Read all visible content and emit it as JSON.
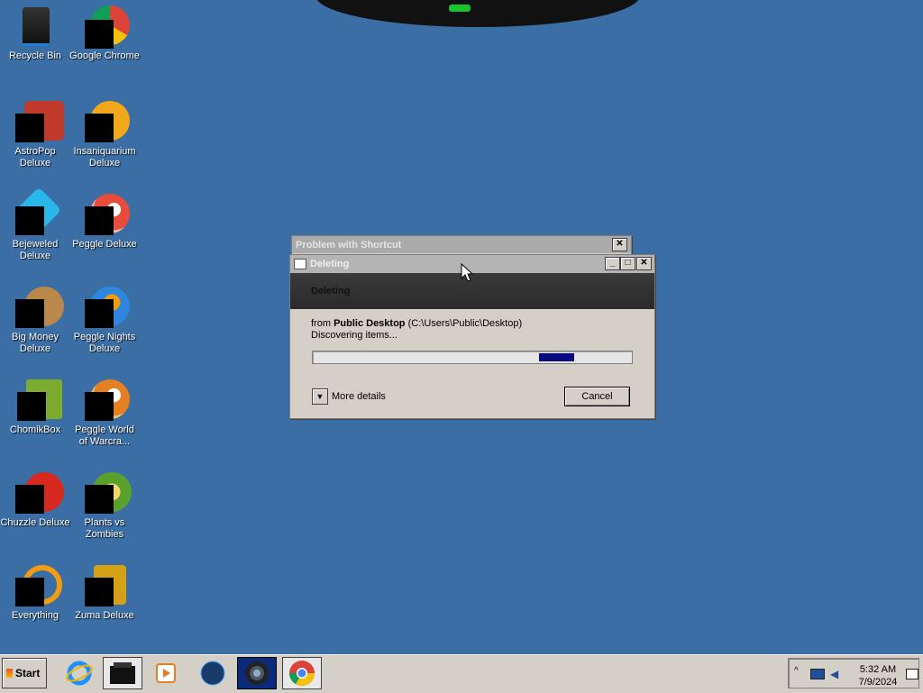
{
  "desktop": {
    "icons": [
      {
        "label": "Recycle Bin",
        "icon": "recycle-bin-icon"
      },
      {
        "label": "Google Chrome",
        "icon": "chrome-icon"
      },
      {
        "label": "AstroPop Deluxe",
        "icon": "astropop-icon"
      },
      {
        "label": "Insaniquarium Deluxe",
        "icon": "insaniquarium-icon"
      },
      {
        "label": "Bejeweled Deluxe",
        "icon": "bejeweled-icon"
      },
      {
        "label": "Peggle Deluxe",
        "icon": "peggle-icon"
      },
      {
        "label": "Big Money Deluxe",
        "icon": "big-money-icon"
      },
      {
        "label": "Peggle Nights Deluxe",
        "icon": "peggle-nights-icon"
      },
      {
        "label": "ChomikBox",
        "icon": "chomikbox-icon"
      },
      {
        "label": "Peggle World of Warcra...",
        "icon": "peggle-wow-icon"
      },
      {
        "label": "Chuzzle Deluxe",
        "icon": "chuzzle-icon"
      },
      {
        "label": "Plants vs Zombies",
        "icon": "plants-vs-zombies-icon"
      },
      {
        "label": "Everything",
        "icon": "everything-icon"
      },
      {
        "label": "Zuma Deluxe",
        "icon": "zuma-icon"
      }
    ]
  },
  "shortcut_dialog": {
    "title": "Problem with Shortcut",
    "close": "✕"
  },
  "deleting_dialog": {
    "title": "Deleting",
    "minimize": "_",
    "maximize": "□",
    "close": "✕",
    "header": "Deleting",
    "from_prefix": "from",
    "from_name": "Public Desktop",
    "from_path": "(C:\\Users\\Public\\Desktop)",
    "status": "Discovering items...",
    "progress_fraction": 0.11,
    "more_details": "More details",
    "cancel": "Cancel"
  },
  "taskbar": {
    "start": "Start",
    "items": [
      {
        "icon": "internet-explorer-icon"
      },
      {
        "icon": "folder-box-icon"
      },
      {
        "icon": "media-player-icon"
      },
      {
        "icon": "globe-icon"
      },
      {
        "icon": "camera-app-icon"
      },
      {
        "icon": "chrome-icon"
      }
    ],
    "clock_time": "5:32 AM",
    "clock_date": "7/9/2024"
  },
  "colors": {
    "desktop_bg": "#3a6ea5",
    "progress_bar": "#0a0a80",
    "header_band": "#2e2e2e"
  }
}
